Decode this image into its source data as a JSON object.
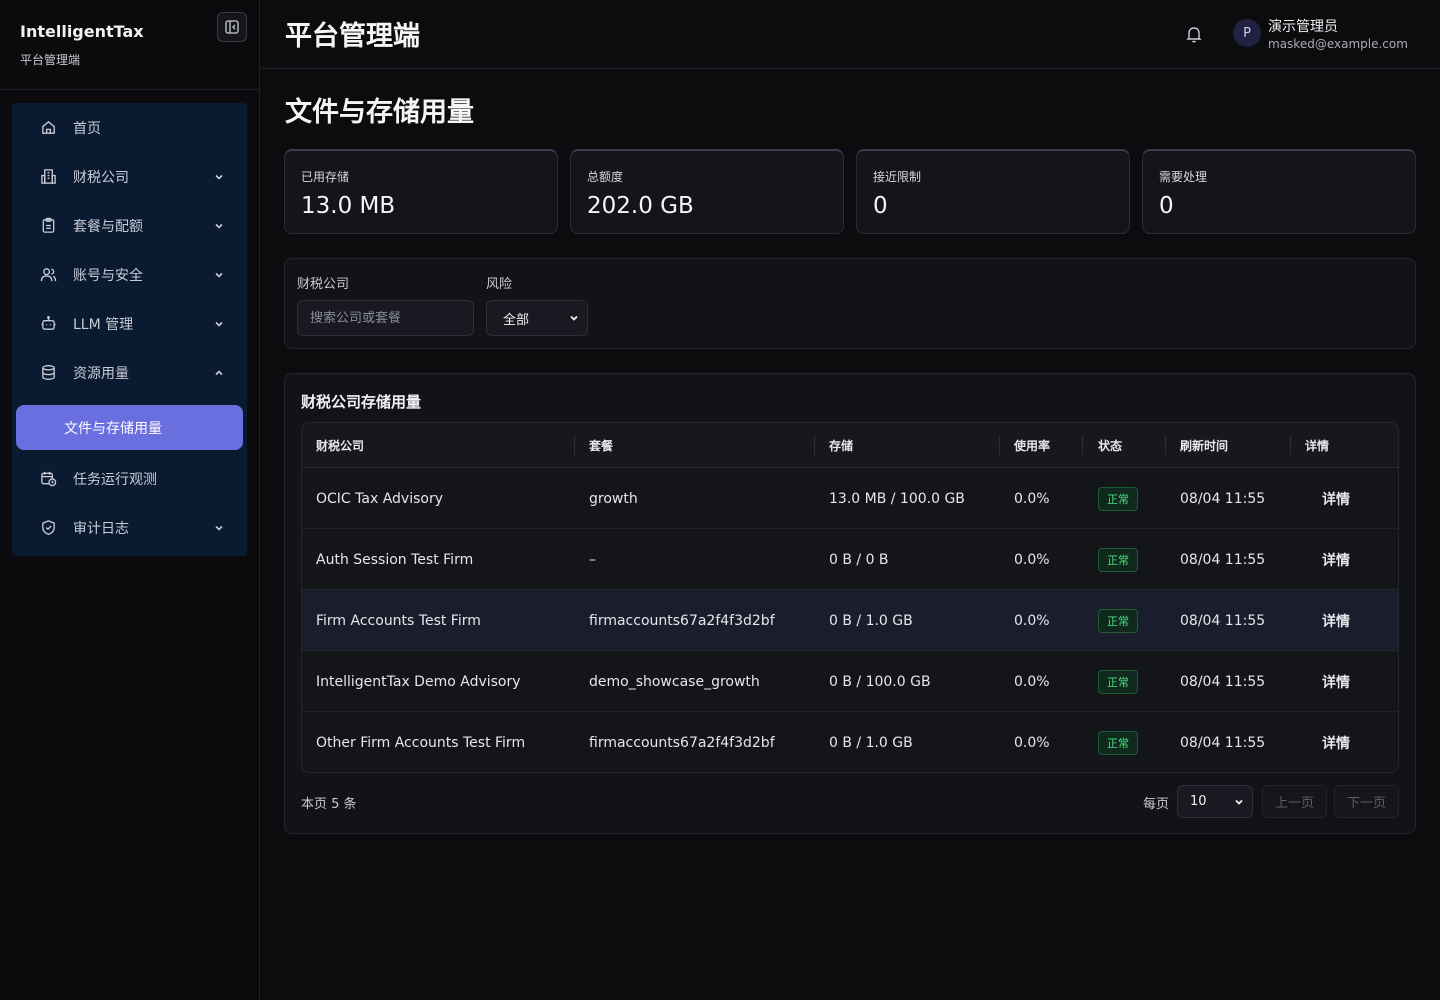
{
  "app": {
    "name": "IntelligentTax",
    "subtitle": "平台管理端"
  },
  "sidebar": {
    "items": [
      {
        "label": "首页",
        "icon": "home-icon"
      },
      {
        "label": "财税公司",
        "icon": "building-icon",
        "expandable": true
      },
      {
        "label": "套餐与配额",
        "icon": "clipboard-icon",
        "expandable": true
      },
      {
        "label": "账号与安全",
        "icon": "users-icon",
        "expandable": true
      },
      {
        "label": "LLM 管理",
        "icon": "robot-icon",
        "expandable": true
      },
      {
        "label": "资源用量",
        "icon": "database-icon",
        "expandable": true,
        "expanded": true
      },
      {
        "label": "任务运行观测",
        "icon": "calendar-clock-icon"
      },
      {
        "label": "审计日志",
        "icon": "shield-check-icon",
        "expandable": true
      }
    ],
    "active_sub": "文件与存储用量"
  },
  "topbar": {
    "title": "平台管理端",
    "user": {
      "initial": "P",
      "name": "演示管理员",
      "email": "masked@example.com"
    }
  },
  "page": {
    "title": "文件与存储用量"
  },
  "stats": [
    {
      "label": "已用存储",
      "value": "13.0 MB"
    },
    {
      "label": "总额度",
      "value": "202.0 GB"
    },
    {
      "label": "接近限制",
      "value": "0"
    },
    {
      "label": "需要处理",
      "value": "0"
    }
  ],
  "filters": {
    "company_label": "财税公司",
    "company_placeholder": "搜索公司或套餐",
    "risk_label": "风险",
    "risk_value": "全部"
  },
  "table": {
    "title": "财税公司存储用量",
    "columns": [
      "财税公司",
      "套餐",
      "存储",
      "使用率",
      "状态",
      "刷新时间",
      "详情"
    ],
    "rows": [
      {
        "company": "OCIC Tax Advisory",
        "plan": "growth",
        "storage": "13.0 MB / 100.0 GB",
        "usage": "0.0%",
        "status": "正常",
        "refreshed": "08/04 11:55",
        "detail": "详情"
      },
      {
        "company": "Auth Session Test Firm",
        "plan": "–",
        "storage": "0 B / 0 B",
        "usage": "0.0%",
        "status": "正常",
        "refreshed": "08/04 11:55",
        "detail": "详情"
      },
      {
        "company": "Firm Accounts Test Firm",
        "plan": "firmaccounts67a2f4f3d2bf",
        "storage": "0 B / 1.0 GB",
        "usage": "0.0%",
        "status": "正常",
        "refreshed": "08/04 11:55",
        "detail": "详情"
      },
      {
        "company": "IntelligentTax Demo Advisory",
        "plan": "demo_showcase_growth",
        "storage": "0 B / 100.0 GB",
        "usage": "0.0%",
        "status": "正常",
        "refreshed": "08/04 11:55",
        "detail": "详情"
      },
      {
        "company": "Other Firm Accounts Test Firm",
        "plan": "firmaccounts67a2f4f3d2bf",
        "storage": "0 B / 1.0 GB",
        "usage": "0.0%",
        "status": "正常",
        "refreshed": "08/04 11:55",
        "detail": "详情"
      }
    ]
  },
  "pager": {
    "summary": "本页 5 条",
    "per_page_label": "每页",
    "per_page_value": "10",
    "prev": "上一页",
    "next": "下一页"
  },
  "colors": {
    "accent": "#6a6fe0",
    "success": "#4ade80",
    "nav_bg": "#0a1a30"
  }
}
